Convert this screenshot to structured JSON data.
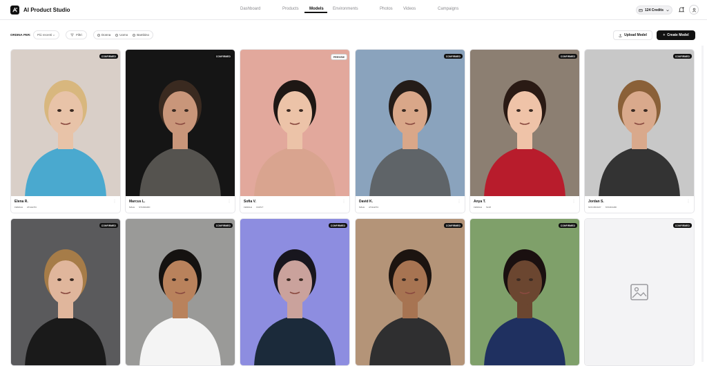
{
  "app": {
    "title": "AI Product Studio"
  },
  "nav": [
    {
      "label": "Dashboard",
      "active": false
    },
    {
      "label": "Products",
      "active": false
    },
    {
      "label": "Models",
      "active": true
    },
    {
      "label": "Environments",
      "active": false
    },
    {
      "label": "Photos",
      "active": false
    },
    {
      "label": "Videos",
      "active": false
    },
    {
      "label": "Campaigns",
      "active": false
    }
  ],
  "header": {
    "credits": "124 Credits"
  },
  "toolbar": {
    "sort_label": "ORDINA PER:",
    "sort_value": "Più recenti",
    "filter_label": "Filtri",
    "tags": [
      "Donna",
      "Uomo",
      "Bambino"
    ],
    "upload_label": "Upload Model",
    "create_label": "Create Model"
  },
  "models": [
    {
      "name": "Elena R.",
      "badge": "CONFIRMED",
      "tags": [
        "FEMALE",
        "ATHLETIC"
      ],
      "bg": "#d9cfc8",
      "skin": "#e8c3a8",
      "hair": "#d8b77e",
      "shirt": "#4aa9cf"
    },
    {
      "name": "Marcus L.",
      "badge": "CONFIRMED",
      "tags": [
        "MALE",
        "STANDARD"
      ],
      "bg": "#151515",
      "skin": "#c9967a",
      "hair": "#3a2a20",
      "shirt": "#55534f"
    },
    {
      "name": "Sofia V.",
      "badge": "PREVIEW",
      "tags": [
        "FEMALE",
        "CURVY"
      ],
      "bg": "#e2a89c",
      "skin": "#ecc3a8",
      "hair": "#1e1714",
      "shirt": "#d9a48f"
    },
    {
      "name": "David K.",
      "badge": "CONFIRMED",
      "tags": [
        "MALE",
        "ATHLETIC"
      ],
      "bg": "#8aa3bd",
      "skin": "#d9a789",
      "hair": "#241c18",
      "shirt": "#5f6468"
    },
    {
      "name": "Anya T.",
      "badge": "CONFIRMED",
      "tags": [
        "FEMALE",
        "SLIM"
      ],
      "bg": "#8c7f72",
      "skin": "#efc3a8",
      "hair": "#2a1a14",
      "shirt": "#b81c2c"
    },
    {
      "name": "Jordan S.",
      "badge": "CONFIRMED",
      "tags": [
        "NON-BINARY",
        "STANDARD"
      ],
      "bg": "#c8c8c8",
      "skin": "#d9a98c",
      "hair": "#8a6038",
      "shirt": "#333333"
    },
    {
      "name": "",
      "badge": "CONFIRMED",
      "tags": [],
      "bg": "#5a5a5c",
      "skin": "#e0b69c",
      "hair": "#a67c48",
      "shirt": "#1a1a1a"
    },
    {
      "name": "",
      "badge": "CONFIRMED",
      "tags": [],
      "bg": "#9a9a98",
      "skin": "#b9825c",
      "hair": "#151210",
      "shirt": "#f4f4f4"
    },
    {
      "name": "",
      "badge": "CONFIRMED",
      "tags": [],
      "bg": "#8d8de0",
      "skin": "#caa29c",
      "hair": "#18161e",
      "shirt": "#1b2a3a"
    },
    {
      "name": "",
      "badge": "CONFIRMED",
      "tags": [],
      "bg": "#b49478",
      "skin": "#a77452",
      "hair": "#1c1410",
      "shirt": "#2f2f30"
    },
    {
      "name": "",
      "badge": "CONFIRMED",
      "tags": [],
      "bg": "#7fa06a",
      "skin": "#6b4630",
      "hair": "#1a1010",
      "shirt": "#1f3060"
    },
    {
      "name": "",
      "badge": "CONFIRMED",
      "tags": [],
      "bg": "#f3f3f5",
      "skin": "",
      "hair": "",
      "shirt": "",
      "placeholder": true
    }
  ]
}
